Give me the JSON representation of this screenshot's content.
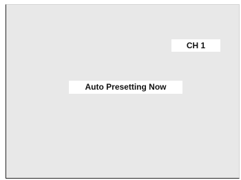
{
  "osd": {
    "channel_label": "CH 1",
    "status_message": "Auto Presetting Now"
  }
}
